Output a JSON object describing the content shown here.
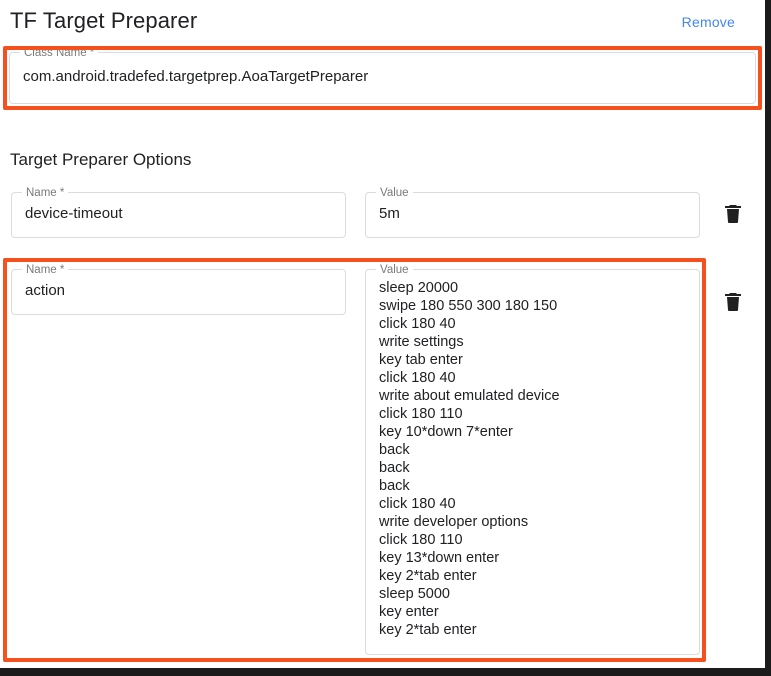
{
  "header": {
    "title": "TF Target Preparer",
    "remove_label": "Remove"
  },
  "class_name_field": {
    "legend": "Class Name *",
    "value": "com.android.tradefed.targetprep.AoaTargetPreparer"
  },
  "options_section": {
    "heading": "Target Preparer Options",
    "rows": [
      {
        "name_legend": "Name *",
        "name_value": "device-timeout",
        "value_legend": "Value",
        "value_value": "5m",
        "delete_icon": "trash-icon"
      },
      {
        "name_legend": "Name *",
        "name_value": "action",
        "value_legend": "Value",
        "value_value": "sleep 20000\nswipe 180 550 300 180 150\nclick 180 40\nwrite settings\nkey tab enter\nclick 180 40\nwrite about emulated device\nclick 180 110\nkey 10*down 7*enter\nback\nback\nback\nclick 180 40\nwrite developer options\nclick 180 110\nkey 13*down enter\nkey 2*tab enter\nsleep 5000\nkey enter\nkey 2*tab enter",
        "delete_icon": "trash-icon"
      }
    ]
  },
  "annotations": {
    "highlight_color": "#f4511e",
    "boxes": [
      "class-name-highlight",
      "action-option-row-highlight"
    ]
  },
  "colors": {
    "link": "#4285f4",
    "text": "#202124",
    "legend": "#7a7a7a",
    "field_border": "#dadce0",
    "background": "#ffffff"
  }
}
